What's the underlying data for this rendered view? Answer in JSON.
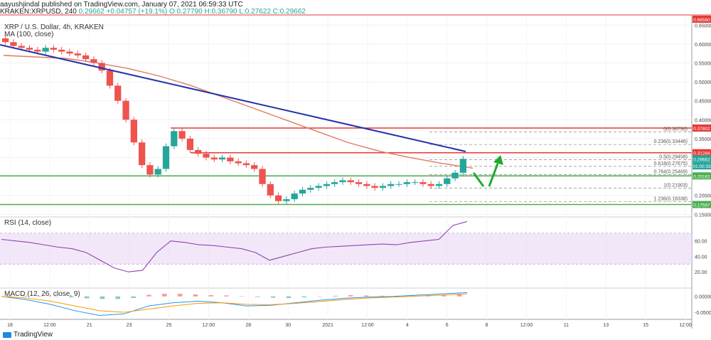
{
  "header": {
    "publisher": "aayushjindal published on TradingView.com, January 07, 2021 06:59:33 UTC",
    "symbol": "KRAKEN:XRPUSD, 240",
    "open": "0.29662",
    "change": "+0.04757 (+19.1%)",
    "ohlc_o": "O:0.27790",
    "ohlc_h": "H:0.36790",
    "ohlc_l": "L:0.27622",
    "ohlc_c": "C:0.29662"
  },
  "main_legend": {
    "title": "XRP / U.S. Dollar, 4h, KRAKEN",
    "ma": "MA (100, close)"
  },
  "rsi_legend": "RSI (14, close)",
  "macd_legend": "MACD (12, 26, close, 9)",
  "branding": "TradingView",
  "colors": {
    "up": "#26a69a",
    "down": "#ef5350",
    "trendline": "#2132a8",
    "ma": "#e07a5f",
    "support": "#4caf50",
    "resistance": "#e53935",
    "rsi_line": "#8e44ad",
    "rsi_band": "#e9d7f5"
  },
  "chart_data": [
    {
      "type": "candlestick",
      "title": "XRP / U.S. Dollar, 4h, KRAKEN",
      "x_tick_labels": [
        "18",
        "12:00",
        "21",
        "23",
        "25",
        "12:00",
        "28",
        "30",
        "2021",
        "12:00",
        "4",
        "6",
        "8",
        "12:00",
        "11",
        "13",
        "15",
        "12:00"
      ],
      "y_tick_labels": [
        "0.15000",
        "0.20000",
        "0.25000",
        "0.30000",
        "0.35000",
        "0.40000",
        "0.45000",
        "0.50000",
        "0.55000",
        "0.60000",
        "0.65000"
      ],
      "ylim": [
        0.145,
        0.675
      ],
      "price_badges": [
        {
          "label": "0.37802",
          "value": 0.378,
          "color": "#e53935"
        },
        {
          "label": "0.31284",
          "value": 0.3128,
          "color": "#e53935"
        },
        {
          "label": "0.29662",
          "value": 0.2966,
          "color": "#26a69a"
        },
        {
          "label": "01:00:33",
          "value": 0.278,
          "color": "#26a69a"
        },
        {
          "label": "0.25162",
          "value": 0.2516,
          "color": "#4caf50"
        },
        {
          "label": "0.17597",
          "value": 0.176,
          "color": "#4caf50"
        },
        {
          "label": "0.66560",
          "value": 0.6656,
          "color": "#e53935"
        }
      ],
      "fib_levels": [
        {
          "label": "0(0.36790)",
          "value": 0.3679
        },
        {
          "label": "0.236(0.33446)",
          "value": 0.3345
        },
        {
          "label": "0.5(0.29458)",
          "value": 0.2946
        },
        {
          "label": "0.618(0.27675)",
          "value": 0.2768
        },
        {
          "label": "0.764(0.25469)",
          "value": 0.2547
        },
        {
          "label": "1(0.21903)",
          "value": 0.219
        },
        {
          "label": "1.236(0.18338)",
          "value": 0.1834
        }
      ],
      "horizontal_lines": [
        {
          "value": 0.378,
          "role": "resistance"
        },
        {
          "value": 0.3128,
          "role": "resistance"
        },
        {
          "value": 0.2516,
          "role": "support"
        },
        {
          "value": 0.176,
          "role": "support"
        }
      ],
      "series": [
        {
          "name": "MA (100, close)",
          "values": [
            0.57,
            0.566,
            0.562,
            0.55,
            0.535,
            0.515,
            0.49,
            0.46,
            0.43,
            0.4,
            0.37,
            0.34,
            0.317,
            0.3,
            0.285,
            0.272
          ]
        }
      ],
      "candles_close": [
        0.605,
        0.595,
        0.59,
        0.585,
        0.58,
        0.59,
        0.585,
        0.58,
        0.575,
        0.57,
        0.56,
        0.55,
        0.53,
        0.49,
        0.45,
        0.4,
        0.34,
        0.28,
        0.255,
        0.27,
        0.33,
        0.37,
        0.35,
        0.32,
        0.31,
        0.3,
        0.295,
        0.3,
        0.29,
        0.285,
        0.28,
        0.27,
        0.23,
        0.2,
        0.185,
        0.19,
        0.205,
        0.215,
        0.22,
        0.225,
        0.23,
        0.235,
        0.24,
        0.235,
        0.23,
        0.225,
        0.22,
        0.225,
        0.23,
        0.23,
        0.235,
        0.235,
        0.23,
        0.225,
        0.23,
        0.245,
        0.26,
        0.2966
      ]
    },
    {
      "type": "line",
      "title": "RSI (14, close)",
      "y_tick_labels": [
        "20.00",
        "40.00",
        "60.00"
      ],
      "ylim": [
        0,
        90
      ],
      "band": [
        30,
        70
      ],
      "values": [
        62,
        60,
        58,
        55,
        52,
        50,
        45,
        35,
        25,
        20,
        22,
        45,
        60,
        58,
        55,
        54,
        52,
        50,
        45,
        35,
        40,
        45,
        50,
        52,
        53,
        54,
        55,
        56,
        55,
        58,
        60,
        62,
        80,
        85
      ]
    },
    {
      "type": "bar",
      "title": "MACD (12, 26, close, 9)",
      "y_tick_labels": [
        "0.00000",
        "-0.05000"
      ],
      "ylim": [
        -0.07,
        0.015
      ],
      "histogram": [
        0.002,
        0.002,
        0.001,
        0.0,
        -0.003,
        -0.006,
        -0.008,
        -0.008,
        -0.005,
        0.005,
        0.008,
        0.008,
        0.006,
        0.004,
        0.003,
        0.001,
        -0.002,
        -0.004,
        -0.005,
        -0.003,
        0.0,
        0.002,
        0.004,
        0.003,
        0.002,
        0.002,
        0.003,
        0.004,
        0.005,
        0.006
      ],
      "series": [
        {
          "name": "MACD",
          "values": [
            0.0,
            -0.01,
            -0.025,
            -0.045,
            -0.06,
            -0.055,
            -0.03,
            -0.02,
            -0.015,
            -0.02,
            -0.03,
            -0.028,
            -0.02,
            -0.012,
            -0.006,
            -0.002,
            0.0,
            0.004,
            0.008,
            0.012
          ]
        },
        {
          "name": "Signal",
          "values": [
            0.0,
            -0.005,
            -0.015,
            -0.03,
            -0.045,
            -0.05,
            -0.04,
            -0.03,
            -0.022,
            -0.02,
            -0.025,
            -0.026,
            -0.022,
            -0.016,
            -0.01,
            -0.005,
            -0.002,
            0.001,
            0.004,
            0.008
          ]
        }
      ]
    }
  ]
}
